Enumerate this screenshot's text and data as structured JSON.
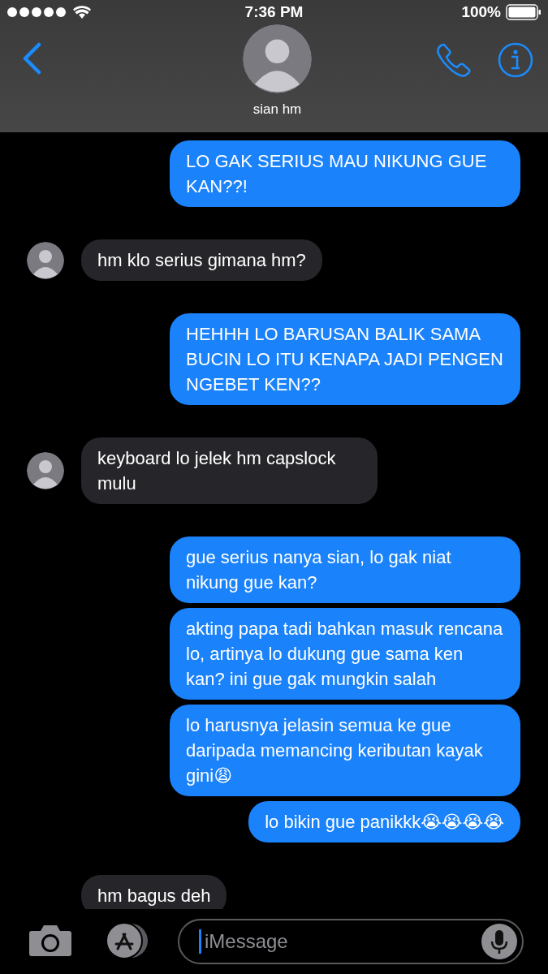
{
  "status_bar": {
    "time": "7:36 PM",
    "battery": "100%"
  },
  "contact": {
    "name": "sian hm"
  },
  "messages": [
    {
      "kind": "sent",
      "text": "LO GAK SERIUS MAU NIKUNG GUE KAN??!"
    },
    {
      "kind": "received",
      "text": "hm klo serius gimana hm?",
      "avatar": true
    },
    {
      "kind": "sent",
      "text": "HEHHH LO BARUSAN BALIK SAMA BUCIN LO ITU KENAPA JADI PENGEN NGEBET KEN??"
    },
    {
      "kind": "received",
      "text": "keyboard lo jelek hm capslock mulu",
      "avatar": true
    },
    {
      "kind": "sent",
      "text": "gue serius nanya sian, lo gak niat nikung gue kan?"
    },
    {
      "kind": "sent",
      "text": "akting papa tadi bahkan masuk rencana lo, artinya lo dukung gue sama ken kan? ini gue gak mungkin salah"
    },
    {
      "kind": "sent",
      "text": "lo harusnya jelasin semua ke gue daripada memancing keributan kayak gini😩"
    },
    {
      "kind": "sent",
      "text": "lo bikin gue panikkk😭😭😭😭"
    },
    {
      "kind": "received",
      "text": "hm bagus deh",
      "avatar": false
    }
  ],
  "compose": {
    "placeholder": "iMessage"
  }
}
